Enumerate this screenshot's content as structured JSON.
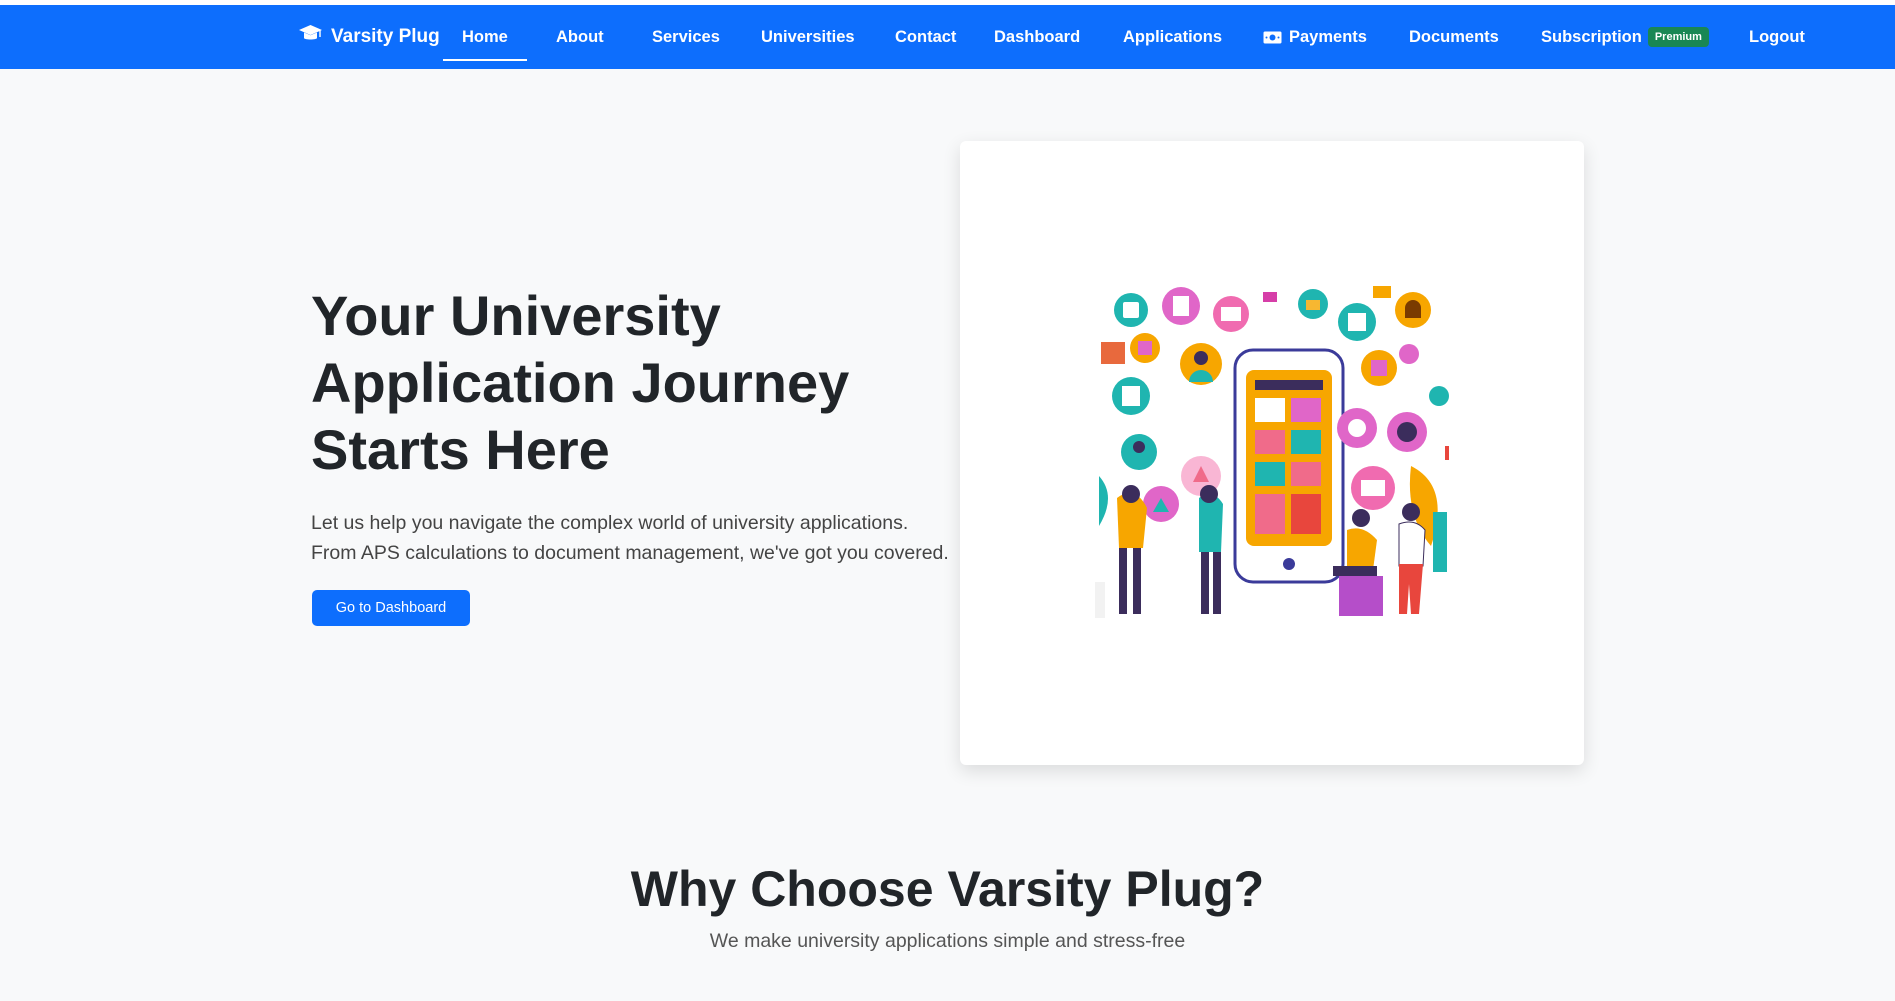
{
  "navbar": {
    "brand": "Varsity Plug",
    "brand_icon": "graduation-cap-icon",
    "items": [
      {
        "label": "Home",
        "active": true
      },
      {
        "label": "About"
      },
      {
        "label": "Services"
      },
      {
        "label": "Universities"
      },
      {
        "label": "Contact"
      },
      {
        "label": "Dashboard"
      },
      {
        "label": "Applications"
      },
      {
        "label": "Payments",
        "icon": "money-icon"
      },
      {
        "label": "Documents"
      },
      {
        "label": "Subscription",
        "badge": "Premium"
      },
      {
        "label": "Logout"
      }
    ],
    "color": "#0d6efd"
  },
  "hero": {
    "title": "Your University Application Journey Starts Here",
    "text_line1": "Let us help you navigate the complex world of university applications.",
    "text_line2": "From APS calculations to document management, we've got you covered.",
    "button": "Go to Dashboard"
  },
  "why": {
    "title": "Why Choose Varsity Plug?",
    "subtitle": "We make university applications simple and stress-free"
  },
  "colors": {
    "primary": "#0d6efd",
    "premium_badge": "#198754",
    "background": "#f8f9fa"
  }
}
